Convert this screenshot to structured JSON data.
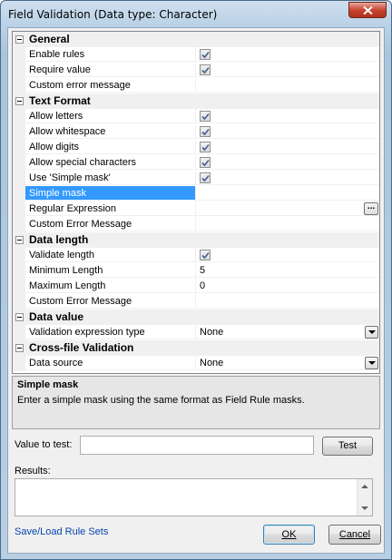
{
  "window": {
    "title": "Field Validation (Data type: Character)"
  },
  "grid": {
    "general": {
      "label": "General",
      "enable_rules": {
        "label": "Enable rules",
        "checked": true
      },
      "require_value": {
        "label": "Require value",
        "checked": true
      },
      "custom_error": {
        "label": "Custom error message",
        "value": ""
      }
    },
    "text_format": {
      "label": "Text Format",
      "allow_letters": {
        "label": "Allow letters",
        "checked": true
      },
      "allow_whitespace": {
        "label": "Allow whitespace",
        "checked": true
      },
      "allow_digits": {
        "label": "Allow digits",
        "checked": true
      },
      "allow_special": {
        "label": "Allow special characters",
        "checked": true
      },
      "use_simple_mask": {
        "label": "Use 'Simple mask'",
        "checked": true
      },
      "simple_mask": {
        "label": "Simple mask",
        "value": ""
      },
      "regex": {
        "label": "Regular Expression",
        "value": "",
        "button": "..."
      },
      "custom_error": {
        "label": "Custom Error Message",
        "value": ""
      }
    },
    "data_length": {
      "label": "Data length",
      "validate_length": {
        "label": "Validate length",
        "checked": true
      },
      "min_length": {
        "label": "Minimum Length",
        "value": "5"
      },
      "max_length": {
        "label": "Maximum Length",
        "value": "0"
      },
      "custom_error": {
        "label": "Custom Error Message",
        "value": ""
      }
    },
    "data_value": {
      "label": "Data value",
      "expr_type": {
        "label": "Validation expression type",
        "value": "None"
      }
    },
    "cross_file": {
      "label": "Cross-file Validation",
      "data_source": {
        "label": "Data source",
        "value": "None"
      }
    }
  },
  "help": {
    "title": "Simple mask",
    "text": "Enter a simple mask using the same format as Field Rule masks."
  },
  "test": {
    "label": "Value to test:",
    "value": "",
    "button": "Test",
    "results_label": "Results:",
    "results_value": ""
  },
  "footer": {
    "link": "Save/Load Rule Sets",
    "ok": "OK",
    "cancel": "Cancel"
  },
  "colors": {
    "selection": "#3399ff",
    "link": "#0645ad"
  }
}
